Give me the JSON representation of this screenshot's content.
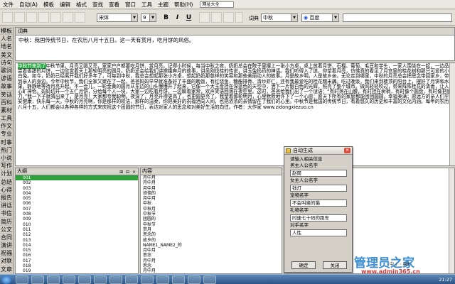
{
  "window_title": "大作家 - [文档1.dzd*]",
  "menu": [
    "文件",
    "自动(A)",
    "模板",
    "编辑",
    "格式",
    "查找",
    "查看",
    "窗口",
    "工具",
    "主题",
    "帮助(H)"
  ],
  "menu_search": "网址大全",
  "toolbar": {
    "font_name": "宋体",
    "font_size": "9",
    "bold": "B",
    "italic": "I",
    "underline": "U",
    "ci_label": "词典",
    "ci_value": "中秋",
    "search_engine": "百度"
  },
  "sidebar": [
    "模板",
    "人名",
    "地名",
    "美文",
    "诗句",
    "歌词",
    "谚语",
    "故事",
    "笑话",
    "百科",
    "素材",
    "工具",
    "作文",
    "专业",
    "时事",
    "热门",
    "小说",
    "写作",
    "计划",
    "总结",
    "心得",
    "报告",
    "讲话",
    "书信",
    "简历",
    "公文",
    "合同",
    "演讲",
    "祝福",
    "对联",
    "文章",
    "查询"
  ],
  "cipanel": {
    "title": "词典",
    "text": "中秋：我国传统节日，在农历八月十五日。这一天有赏月，吃月饼的风俗。"
  },
  "document": {
    "highlight": "中秋节来到了",
    "text": "中秋节里，月亮又圆又亮，家家户户都要吃月饼、赏月亮。记得小时候，每当中秋之夜，奶奶总会在院子里摆上一张小方桌，桌上放着月饼、石榴、葡萄、毛豆和芋头，一家人围坐在一起，一边品尝着香甜的月饼，一边欣赏着天上那轮明亮的圆月。奶奶还会给我们讲嫦娥奔月的故事，讲吴刚伐桂的传说，讲玉兔捣药的神话。我们听得入了迷，仰望着月亮，仿佛真的看见了月宫里的桂花树和那只可爱的小白兔。如今，奶奶已经离开我们好多年了，可每到中秋，我总会想起那张小方桌，想起奶奶那慈祥的笑容和那些美丽动人的故事。月是故乡明，人是故乡亲。无论走到哪里，中秋的月亮总会把思念带回家乡，带到亲人的身边。今年中秋节，我们全家又聚在了一起，爸爸妈妈早早就准备好了丰盛的晚饭，有红烧鱼、糖醋排骨、清炒虾仁，还有我最爱吃的桂花糯米藕。吃过晚饭，我们来到楼顶的阳台上，摆好了月饼和水果，静静地等待月亮升起。不一会儿，一轮金黄的圆月从东边的山头慢慢升了起来，它像一个大玉盘挂在深蓝色的天空中，洒下一片银白色的光辉，照亮了整个城市。微风轻轻吹过，带来阵阵桂花的清香，让人心旷神怡。妈妈切开一个五仁月饼，分给每个人一块，大家一边吃着月饼，一边聊着家常，欢声笑语回荡在夜空里。这时，爸爸给我们出了一个谜语：“有时落在山腰，有时挂在树梢，有时像个圆盘，有时像把镰刀。”我一下子就猜出来了，是月亮！大家都夸我聪明。夜深了，月亮升得更高了，也更圆更亮了。我望着那轮明月，心里默默地许下了一个心愿：愿天下所有的家庭都能团团圆圆，幸福美满；愿远方的亲人们平安健康，快乐每一天。中秋的月亮啊，你是那样的皎洁，那样的温柔，你把美好的祝福洒向人间，也把浓浓的亲情留在了我们的心里。中秋节是我国的传统节日，有着悠久的历史和丰富的文化内涵。每年的农历八月十五，人们都会以各种各样的方式来庆祝这个团圆的节日，表达对家人的思念和对美好生活的向往。作者：大作家 www.zidongxiezuo.cn"
  },
  "outline": {
    "title": "大纲",
    "header_buttons": "⊞ ⊟ ×",
    "items": [
      "001",
      "002",
      "003",
      "004",
      "005",
      "006",
      "007",
      "008",
      "009",
      "010",
      "011",
      "012",
      "013",
      "014",
      "015",
      "016",
      "017",
      "018",
      "019"
    ]
  },
  "content": {
    "title": "内容",
    "items": [
      "月中月",
      "月中月",
      "月中月",
      "烦恼的",
      "月中月",
      "中秋",
      "中秋月",
      "中秋节",
      "团圆的",
      "中秋节",
      "赏月",
      "思念的",
      "故乡的",
      "NAME1_NAME2_的",
      "月中月",
      "思念",
      "月中月",
      "思念",
      "月中月"
    ]
  },
  "dialog": {
    "title": "自动生成",
    "prompt": "请输入相关信息",
    "fields": [
      {
        "label": "男主人公名字",
        "value": "赵周"
      },
      {
        "label": "女主人公名字",
        "value": "钱灯"
      },
      {
        "label": "宠物名字",
        "value": "不会叫唤的猫"
      },
      {
        "label": "礼物名字",
        "value": "时速七十码的跑车"
      },
      {
        "label": "对手名字",
        "value": "人性"
      }
    ],
    "ok": "确定",
    "cancel": "关闭"
  },
  "brand": {
    "name": "管理员之家",
    "url": "www.admin365.cn"
  },
  "ime": "中 ♪ ◦ ⌨",
  "clock": "21:27"
}
